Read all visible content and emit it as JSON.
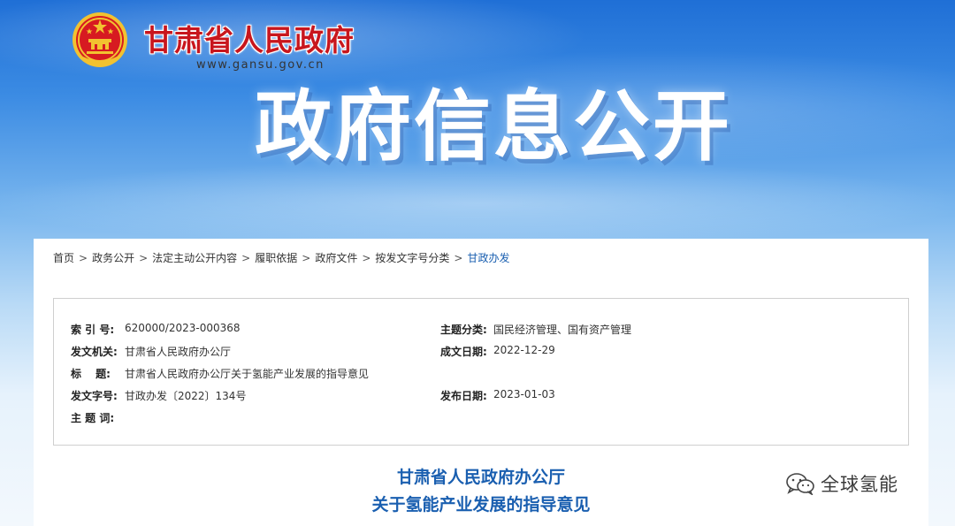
{
  "header": {
    "site_title": "甘肃省人民政府",
    "site_url": "www.gansu.gov.cn",
    "banner_title": "政府信息公开",
    "emblem_name": "national-emblem",
    "accent_color": "#c8161d"
  },
  "breadcrumb": {
    "items": [
      "首页",
      "政务公开",
      "法定主动公开内容",
      "履职依据",
      "政府文件",
      "按发文字号分类",
      "甘政办发"
    ],
    "separator": ">"
  },
  "meta": {
    "index_label": "索 引 号:",
    "index_value": "620000/2023-000368",
    "topic_label": "主题分类:",
    "topic_value": "国民经济管理、国有资产管理",
    "issuer_label": "发文机关:",
    "issuer_value": "甘肃省人民政府办公厅",
    "created_label": "成文日期:",
    "created_value": "2022-12-29",
    "title_label": "标　 题:",
    "title_value": "甘肃省人民政府办公厅关于氢能产业发展的指导意见",
    "docno_label": "发文字号:",
    "docno_value": "甘政办发〔2022〕134号",
    "published_label": "发布日期:",
    "published_value": "2023-01-03",
    "keywords_label": "主 题 词:",
    "keywords_value": ""
  },
  "document": {
    "title_line1": "甘肃省人民政府办公厅",
    "title_line2": "关于氢能产业发展的指导意见",
    "title_color": "#1a5fb0"
  },
  "watermark": {
    "text": "全球氢能",
    "icon": "wechat-icon"
  }
}
